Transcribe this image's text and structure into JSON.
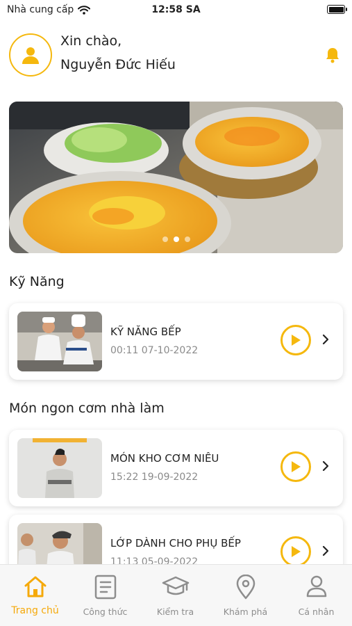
{
  "status_bar": {
    "carrier": "Nhà cung cấp",
    "time": "12:58 SA"
  },
  "header": {
    "greeting": "Xin chào,",
    "user_name": "Nguyễn Đức Hiếu"
  },
  "banner": {
    "slide_count": 3,
    "active_slide": 1
  },
  "sections": [
    {
      "title": "Kỹ Năng",
      "items": [
        {
          "title": "KỸ NĂNG BẾP",
          "date": "00:11 07-10-2022",
          "thumb_icon": "chef-team-photo"
        }
      ]
    },
    {
      "title": "Món ngon cơm nhà làm",
      "items": [
        {
          "title": "MÓN KHO CƠM NIÊU",
          "date": "15:22 19-09-2022",
          "thumb_icon": "chef-portrait-photo"
        },
        {
          "title": "LỚP DÀNH CHO PHỤ BẾP",
          "date": "11:13 05-09-2022",
          "thumb_icon": "kitchen-staff-photo"
        }
      ]
    }
  ],
  "tabbar": {
    "tabs": [
      {
        "label": "Trang chủ",
        "icon": "home-icon",
        "active": true
      },
      {
        "label": "Công thức",
        "icon": "document-icon",
        "active": false
      },
      {
        "label": "Kiểm tra",
        "icon": "graduation-cap-icon",
        "active": false
      },
      {
        "label": "Khám phá",
        "icon": "location-pin-icon",
        "active": false
      },
      {
        "label": "Cá nhân",
        "icon": "person-icon",
        "active": false
      }
    ]
  },
  "colors": {
    "accent": "#f5b80e",
    "accent_text": "#f5a90a",
    "muted": "#8a8a8a"
  }
}
